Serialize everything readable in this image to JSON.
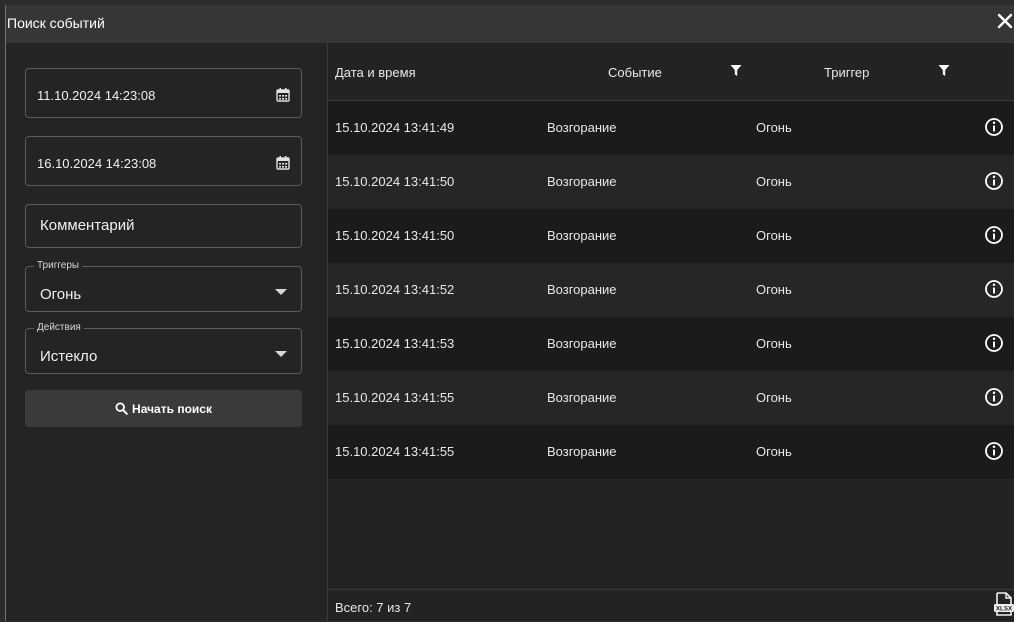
{
  "window": {
    "title": "Поиск событий"
  },
  "filters": {
    "date_from": "11.10.2024 14:23:08",
    "date_to": "16.10.2024 14:23:08",
    "comment_placeholder": "Комментарий",
    "triggers": {
      "legend": "Триггеры",
      "value": "Огонь"
    },
    "actions": {
      "legend": "Действия",
      "value": "Истекло"
    },
    "search_button": "Начать поиск"
  },
  "table": {
    "columns": {
      "date": "Дата и время",
      "event": "Событие",
      "trigger": "Триггер"
    },
    "rows": [
      {
        "date": "15.10.2024 13:41:49",
        "event": "Возгорание",
        "trigger": "Огонь"
      },
      {
        "date": "15.10.2024 13:41:50",
        "event": "Возгорание",
        "trigger": "Огонь"
      },
      {
        "date": "15.10.2024 13:41:50",
        "event": "Возгорание",
        "trigger": "Огонь"
      },
      {
        "date": "15.10.2024 13:41:52",
        "event": "Возгорание",
        "trigger": "Огонь"
      },
      {
        "date": "15.10.2024 13:41:53",
        "event": "Возгорание",
        "trigger": "Огонь"
      },
      {
        "date": "15.10.2024 13:41:55",
        "event": "Возгорание",
        "trigger": "Огонь"
      },
      {
        "date": "15.10.2024 13:41:55",
        "event": "Возгорание",
        "trigger": "Огонь"
      }
    ],
    "footer_total": "Всего: 7 из 7"
  },
  "icons": {
    "close": "close-icon",
    "calendar": "calendar-icon",
    "dropdown": "chevron-down-icon",
    "search": "search-icon",
    "filter": "filter-icon",
    "info": "info-icon",
    "export": "xlsx-export-icon"
  },
  "colors": {
    "panel": "#232323",
    "titlebar": "#363636",
    "row_dark": "#1b1b1b",
    "row_light": "#262626",
    "button": "#3a3a3a",
    "border": "#5c5c5c",
    "accent_edge": "#3a7bd5"
  }
}
